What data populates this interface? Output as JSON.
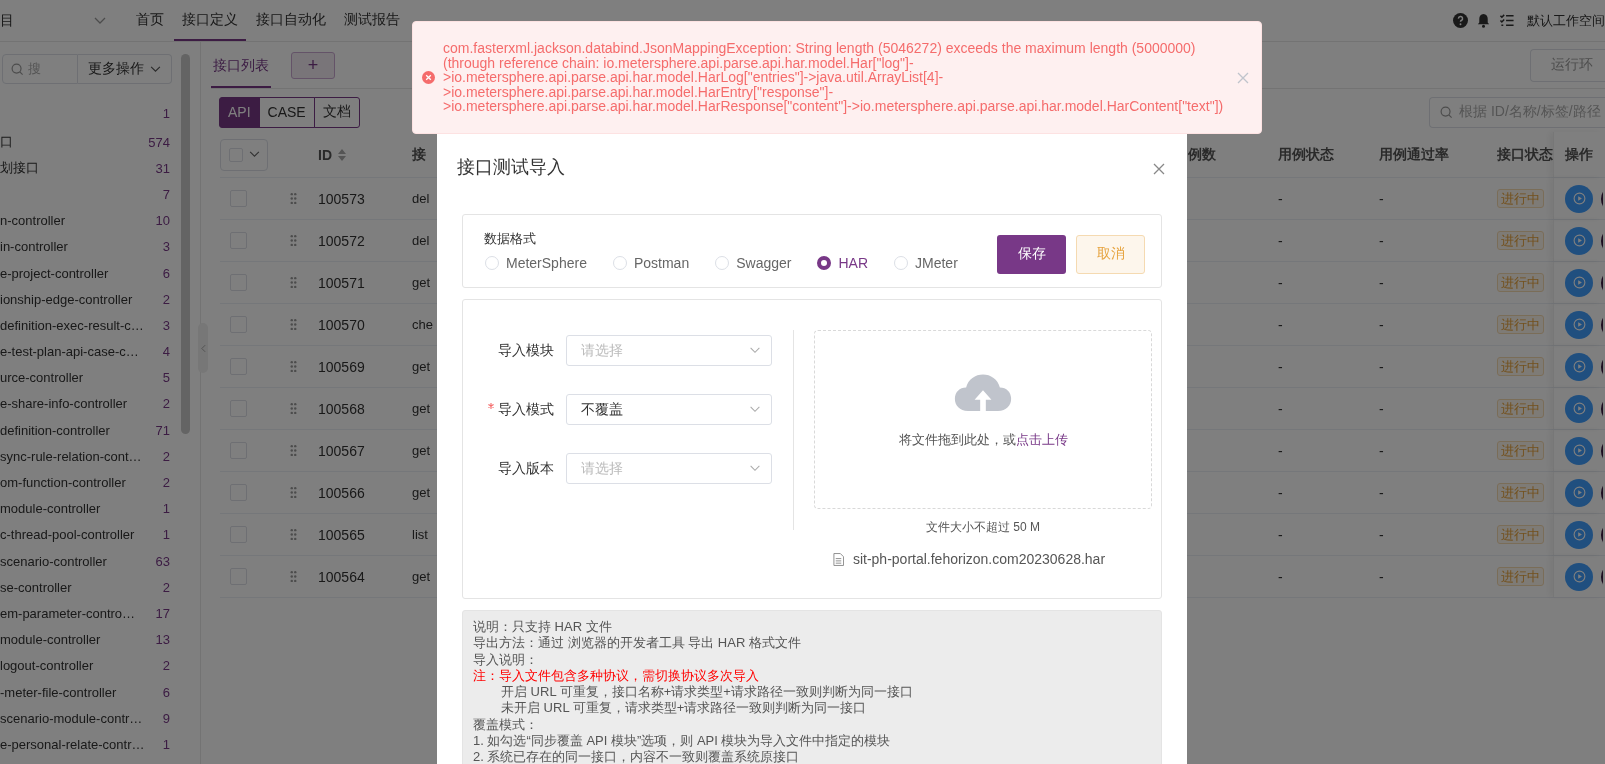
{
  "header": {
    "project": "目",
    "nav": [
      {
        "label": "首页",
        "selected": false
      },
      {
        "label": "接口定义",
        "selected": true
      },
      {
        "label": "接口自动化",
        "selected": false
      },
      {
        "label": "测试报告",
        "selected": false
      }
    ],
    "workspace": "默认工作空间"
  },
  "sidebar": {
    "search_placeholder": "搜",
    "more_actions": "更多操作",
    "items": [
      {
        "count": "1"
      },
      {
        "name": "口",
        "count": "574"
      },
      {
        "name": "划接口",
        "count": "31"
      },
      {
        "count": "7"
      },
      {
        "name": "n-controller",
        "count": "10"
      },
      {
        "name": "in-controller",
        "count": "3"
      },
      {
        "name": "e-project-controller",
        "count": "6"
      },
      {
        "name": "ionship-edge-controller",
        "count": "2"
      },
      {
        "name": "definition-exec-result-c…",
        "count": "3"
      },
      {
        "name": "e-test-plan-api-case-c…",
        "count": "4"
      },
      {
        "name": "urce-controller",
        "count": "5"
      },
      {
        "name": "e-share-info-controller",
        "count": "2"
      },
      {
        "name": "definition-controller",
        "count": "71"
      },
      {
        "name": "sync-rule-relation-cont…",
        "count": "2"
      },
      {
        "name": "om-function-controller",
        "count": "2"
      },
      {
        "name": "module-controller",
        "count": "1"
      },
      {
        "name": "c-thread-pool-controller",
        "count": "1"
      },
      {
        "name": "scenario-controller",
        "count": "63"
      },
      {
        "name": "se-controller",
        "count": "2"
      },
      {
        "name": "em-parameter-contro…",
        "count": "17"
      },
      {
        "name": "module-controller",
        "count": "13"
      },
      {
        "name": "logout-controller",
        "count": "2"
      },
      {
        "name": "-meter-file-controller",
        "count": "6"
      },
      {
        "name": "scenario-module-contr…",
        "count": "9"
      },
      {
        "name": "e-personal-relate-contr…",
        "count": "1"
      }
    ]
  },
  "main": {
    "tabs": [
      {
        "label": "接口列表",
        "selected": true
      }
    ],
    "add_button": "+",
    "env_button": "运行环",
    "modes": [
      {
        "label": "API",
        "selected": true
      },
      {
        "label": "CASE",
        "selected": false
      },
      {
        "label": "文档",
        "selected": false
      }
    ],
    "search_placeholder": "根据 ID/名称/标签/路径",
    "table": {
      "columns": {
        "id": "ID",
        "name": "接",
        "case_count": "例数",
        "case_status": "用例状态",
        "pass_rate": "用例通过率",
        "api_status": "接口状态",
        "actions": "操作"
      },
      "rows": [
        {
          "checked": false,
          "id": "100573",
          "name": "del",
          "case_status": "-",
          "pass_rate": "-",
          "status": "进行中"
        },
        {
          "checked": false,
          "id": "100572",
          "name": "del",
          "case_status": "-",
          "pass_rate": "-",
          "status": "进行中"
        },
        {
          "checked": false,
          "id": "100571",
          "name": "get",
          "case_status": "-",
          "pass_rate": "-",
          "status": "进行中"
        },
        {
          "checked": false,
          "id": "100570",
          "name": "che",
          "case_status": "-",
          "pass_rate": "-",
          "status": "进行中"
        },
        {
          "checked": false,
          "id": "100569",
          "name": "get",
          "case_status": "-",
          "pass_rate": "-",
          "status": "进行中"
        },
        {
          "checked": false,
          "id": "100568",
          "name": "get",
          "case_status": "-",
          "pass_rate": "-",
          "status": "进行中"
        },
        {
          "checked": false,
          "id": "100567",
          "name": "get",
          "case_status": "-",
          "pass_rate": "-",
          "status": "进行中"
        },
        {
          "checked": false,
          "id": "100566",
          "name": "get",
          "case_status": "-",
          "pass_rate": "-",
          "status": "进行中"
        },
        {
          "checked": false,
          "id": "100565",
          "name": "list",
          "case_status": "-",
          "pass_rate": "-",
          "status": "进行中"
        },
        {
          "checked": false,
          "id": "100564",
          "name": "get",
          "case_status": "-",
          "pass_rate": "-",
          "status": "进行中"
        }
      ]
    }
  },
  "modal": {
    "title": "接口测试导入",
    "format": {
      "label": "数据格式",
      "options": [
        {
          "label": "MeterSphere",
          "selected": false
        },
        {
          "label": "Postman",
          "selected": false
        },
        {
          "label": "Swagger",
          "selected": false
        },
        {
          "label": "HAR",
          "selected": true
        },
        {
          "label": "JMeter",
          "selected": false
        }
      ]
    },
    "save": "保存",
    "cancel": "取消",
    "form": [
      {
        "label": "导入模块",
        "required": false,
        "placeholder": "请选择"
      },
      {
        "label": "导入模式",
        "required": true,
        "value": "不覆盖"
      },
      {
        "label": "导入版本",
        "required": false,
        "placeholder": "请选择"
      }
    ],
    "upload": {
      "hint": "将文件拖到此处，或",
      "link": "点击上传",
      "tip": "文件大小不超过 50 M",
      "file": "sit-ph-portal.fehorizon.com20230628.har"
    },
    "notes": [
      {
        "kind": "plain",
        "text": "说明：只支持 HAR 文件"
      },
      {
        "kind": "plain",
        "text": "导出方法：通过 浏览器的开发者工具 导出 HAR 格式文件"
      },
      {
        "kind": "plain",
        "text": "导入说明："
      },
      {
        "kind": "warning",
        "text": "注：导入文件包含多种协议，需切换协议多次导入"
      },
      {
        "kind": "indented",
        "text": "开启 URL 可重复，接口名称+请求类型+请求路径一致则判断为同一接口"
      },
      {
        "kind": "indented",
        "text": "未开启 URL 可重复，请求类型+请求路径一致则判断为同一接口"
      },
      {
        "kind": "plain",
        "text": "覆盖模式："
      },
      {
        "kind": "plain",
        "text": "1. 如勾选“同步覆盖 API 模块”选项，则 API 模块为导入文件中指定的模块"
      },
      {
        "kind": "plain",
        "text": "2. 系统已存在的同一接口，内容不一致则覆盖系统原接口"
      }
    ]
  },
  "toast": {
    "kind": "error",
    "message": "com.fasterxml.jackson.databind.JsonMappingException: String length (5046272) exceeds the maximum length (5000000) (through reference chain: io.metersphere.api.parse.api.har.model.Har[\"log\"]->io.metersphere.api.parse.api.har.model.HarLog[\"entries\"]->java.util.ArrayList[4]->io.metersphere.api.parse.api.har.model.HarEntry[\"response\"]->io.metersphere.api.parse.api.har.model.HarResponse[\"content\"]->io.metersphere.api.parse.api.har.model.HarContent[\"text\"])"
  }
}
